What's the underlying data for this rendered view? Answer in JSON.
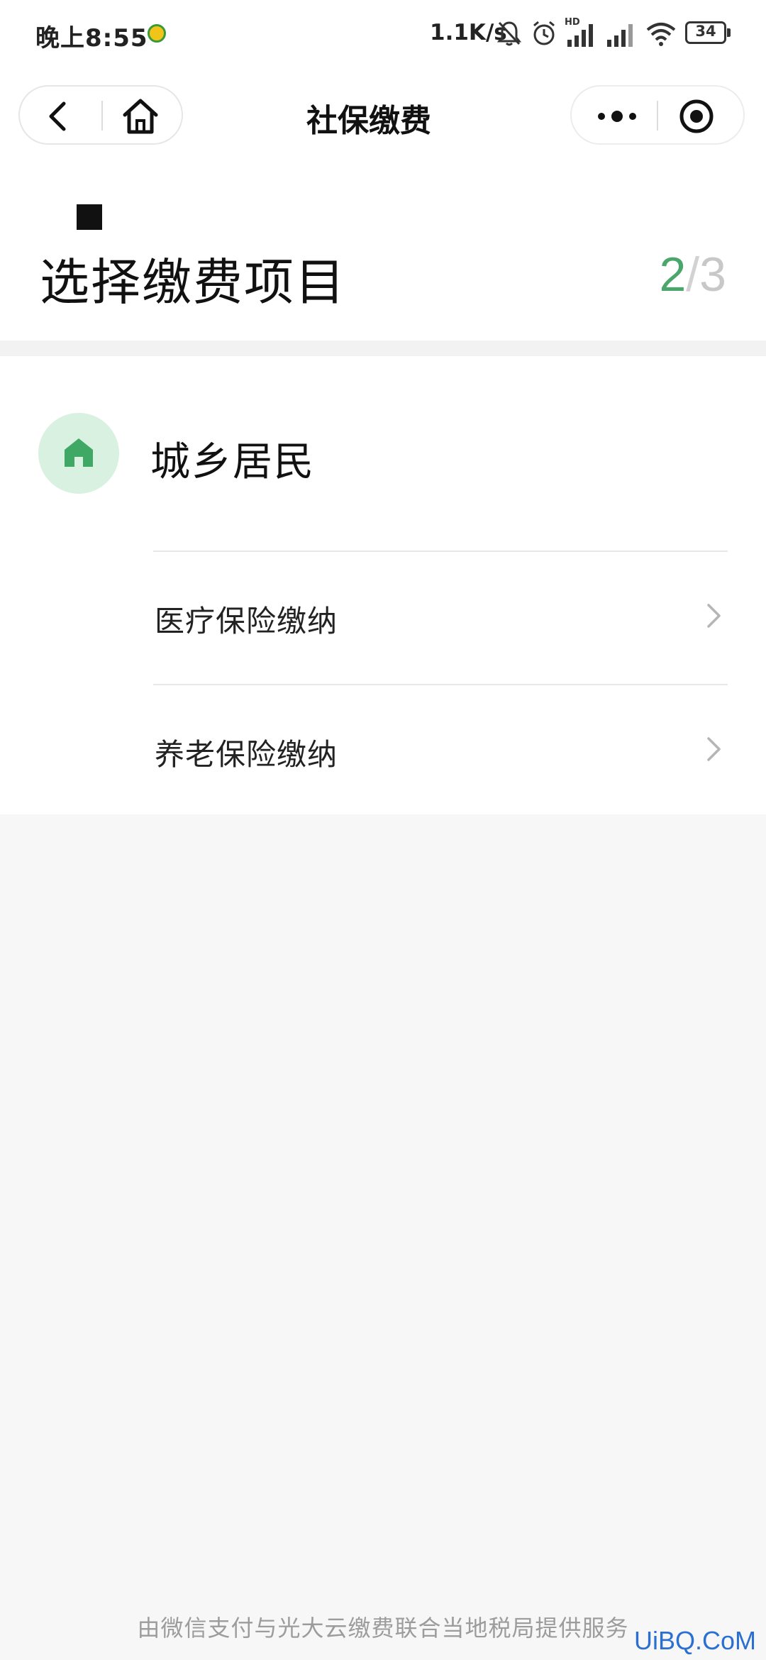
{
  "status_bar": {
    "time": "晚上8:55",
    "network_speed": "1.1K/s",
    "battery": "34",
    "network_type": "HD"
  },
  "nav_bar": {
    "title": "社保缴费"
  },
  "header": {
    "title": "选择缴费项目",
    "step_current": "2",
    "step_separator": "/",
    "step_total": "3"
  },
  "category": {
    "title": "城乡居民",
    "icon": "house-icon",
    "items": [
      {
        "label": "医疗保险缴纳"
      },
      {
        "label": "养老保险缴纳"
      }
    ]
  },
  "footer": {
    "text": "由微信支付与光大云缴费联合当地税局提供服务"
  },
  "watermark": "UiBQ.CoM",
  "colors": {
    "accent_green": "#4aa66b",
    "icon_bg": "#d9f1e1",
    "page_bg": "#f7f7f7",
    "watermark_blue": "#2a6fd1"
  }
}
